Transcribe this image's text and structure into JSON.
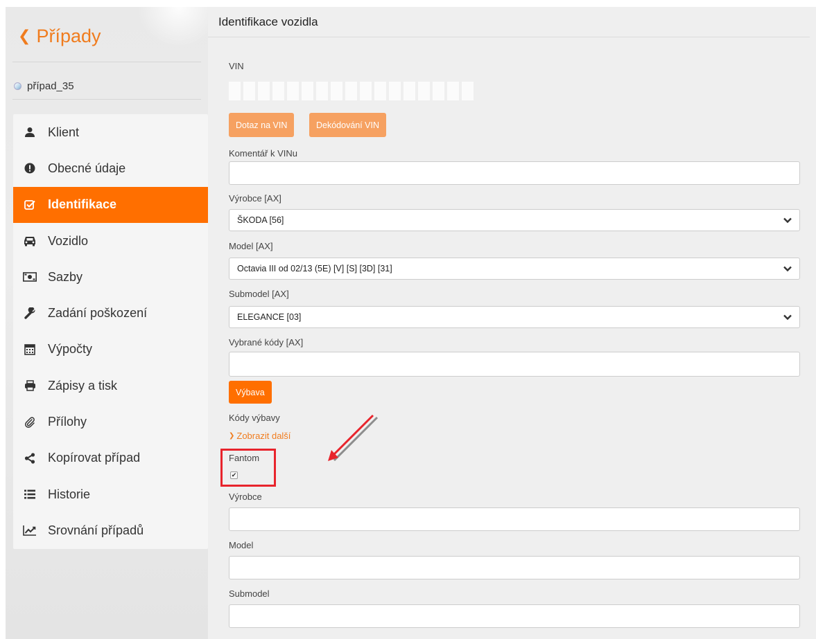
{
  "sidebar": {
    "back_label": "Případy",
    "case_name": "případ_35",
    "items": [
      {
        "label": "Klient",
        "icon": "user-icon"
      },
      {
        "label": "Obecné údaje",
        "icon": "exclamation-circle-icon"
      },
      {
        "label": "Identifikace",
        "icon": "check-square-icon",
        "active": true
      },
      {
        "label": "Vozidlo",
        "icon": "car-icon"
      },
      {
        "label": "Sazby",
        "icon": "money-icon"
      },
      {
        "label": "Zadání poškození",
        "icon": "wrench-icon"
      },
      {
        "label": "Výpočty",
        "icon": "calculator-icon"
      },
      {
        "label": "Zápisy a tisk",
        "icon": "printer-icon"
      },
      {
        "label": "Přílohy",
        "icon": "paperclip-icon"
      },
      {
        "label": "Kopírovat případ",
        "icon": "share-icon"
      },
      {
        "label": "Historie",
        "icon": "list-icon"
      },
      {
        "label": "Srovnání případů",
        "icon": "line-chart-icon"
      }
    ]
  },
  "main": {
    "title": "Identifikace vozidla",
    "vin_label": "VIN",
    "vin_query_button": "Dotaz na VIN",
    "vin_decode_button": "Dekódování VIN",
    "vin_comment_label": "Komentář k VINu",
    "vin_comment_value": "",
    "manufacturer_ax_label": "Výrobce [AX]",
    "manufacturer_ax_value": "ŠKODA [56]",
    "model_ax_label": "Model [AX]",
    "model_ax_value": "Octavia III od 02/13 (5E) [V] [S] [3D] [31]",
    "submodel_ax_label": "Submodel [AX]",
    "submodel_ax_value": "ELEGANCE [03]",
    "selected_codes_label": "Vybrané kódy [AX]",
    "selected_codes_value": "",
    "equipment_button": "Výbava",
    "equipment_codes_label": "Kódy výbavy",
    "show_more_label": "Zobrazit další",
    "fantom_label": "Fantom",
    "fantom_checked": true,
    "manufacturer_label": "Výrobce",
    "manufacturer_value": "",
    "model_label": "Model",
    "model_value": "",
    "submodel_label": "Submodel",
    "submodel_value": ""
  },
  "colors": {
    "accent": "#ff6f00",
    "accent_light": "#f6a161",
    "link": "#f07c1e",
    "highlight": "#e8242c"
  }
}
